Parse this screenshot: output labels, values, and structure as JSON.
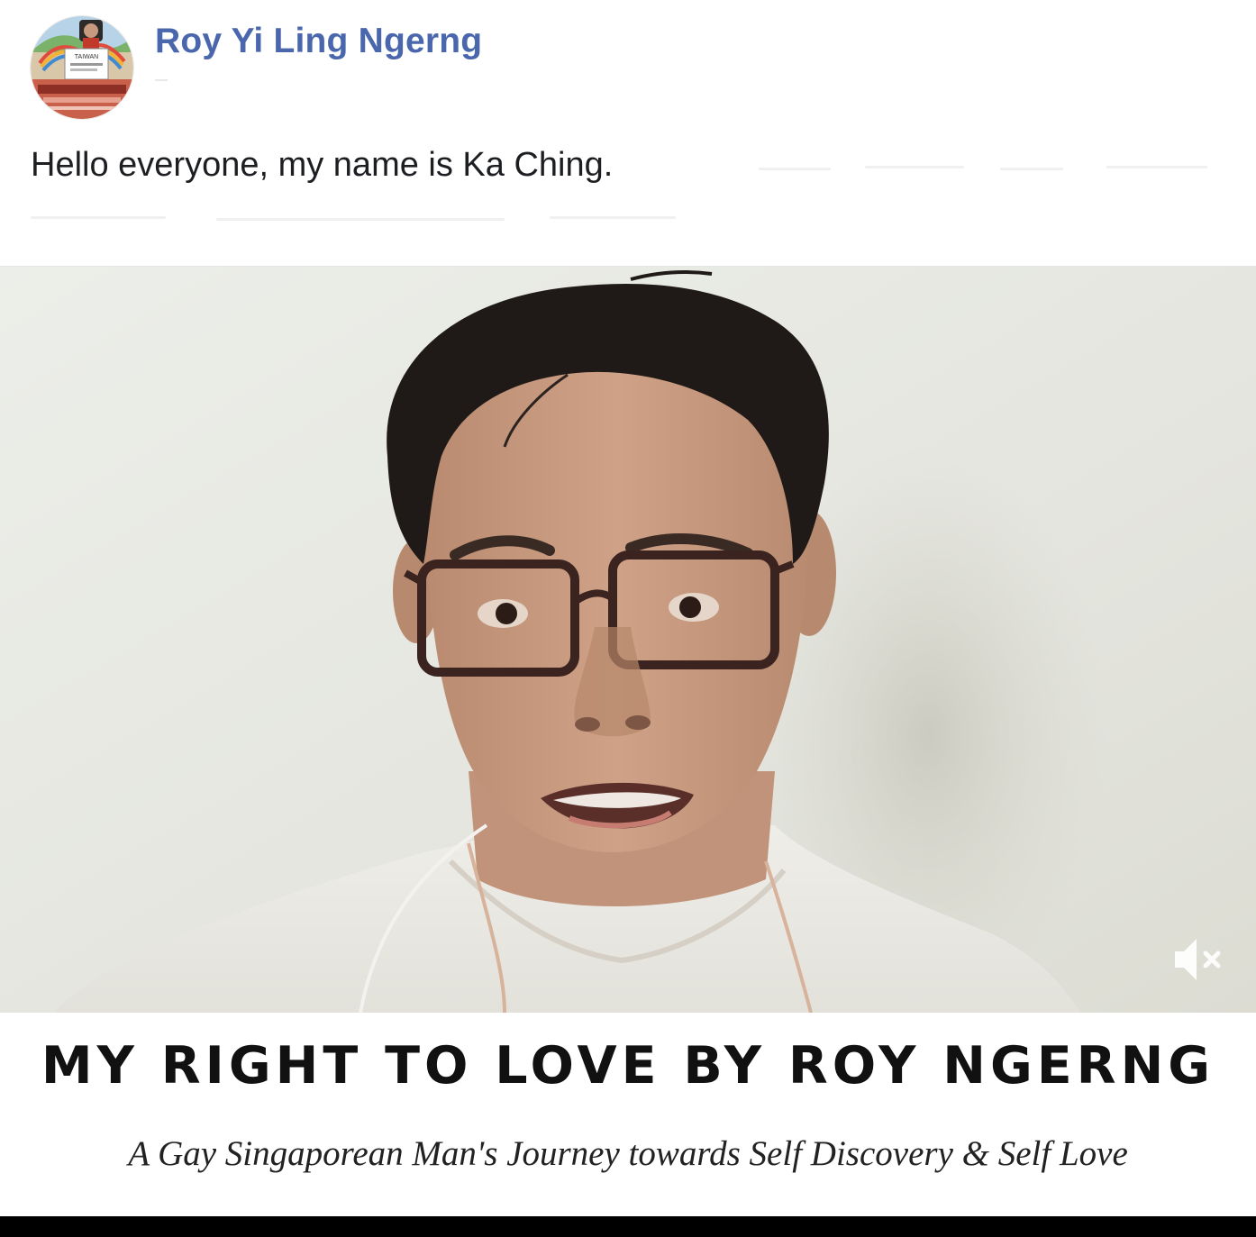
{
  "post": {
    "author_name": "Roy Yi Ling Ngerng",
    "text": "Hello everyone, my name is Ka Ching.",
    "avatar_icon": "profile-photo-avatar",
    "avatar_badge_text": "TAIWAN"
  },
  "video": {
    "mute_icon": "speaker-muted-icon"
  },
  "banner": {
    "title": "MY RIGHT TO LOVE BY ROY NGERNG",
    "subtitle": "A Gay Singaporean Man's Journey towards Self Discovery & Self Love"
  },
  "colors": {
    "link": "#4a67ad",
    "text": "#1c1e21",
    "wall": "#e6e7e2",
    "shirt": "#ecebe6",
    "skin": "#c79a7f",
    "hair": "#1f1a18"
  }
}
